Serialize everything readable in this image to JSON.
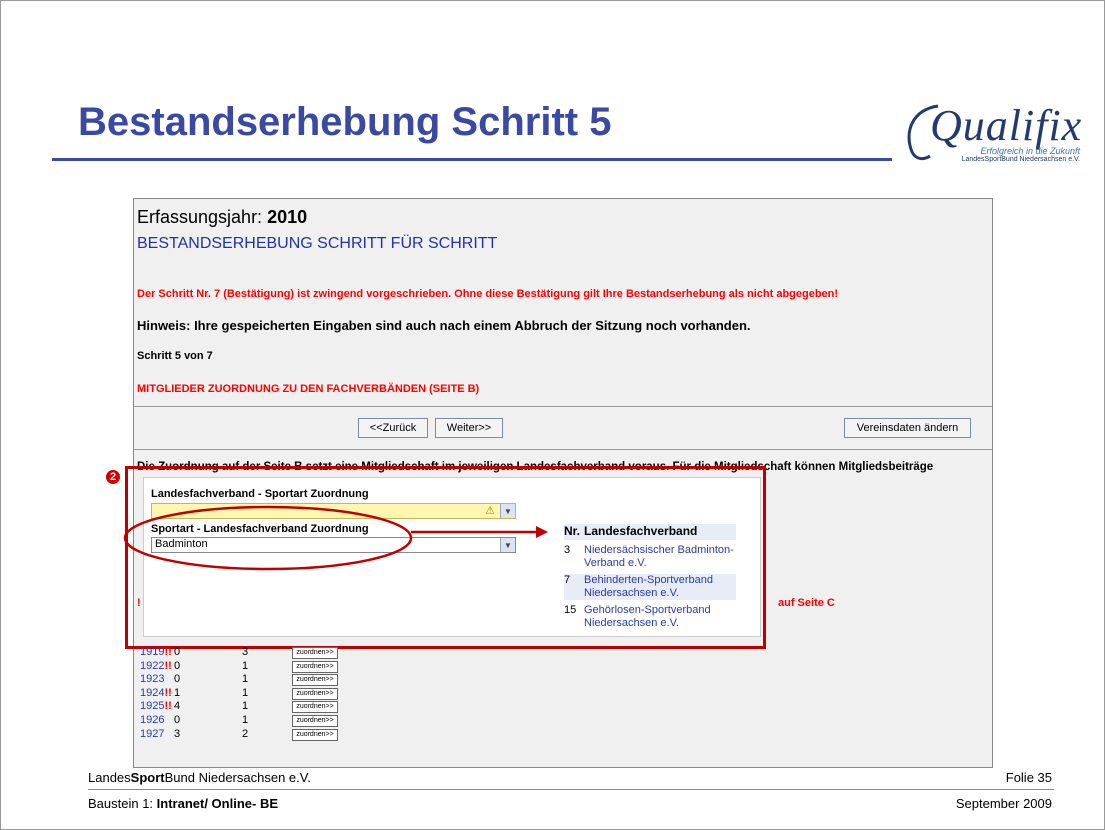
{
  "slide": {
    "title": "Bestandserhebung Schritt 5",
    "logo": {
      "name": "Qualifix",
      "tagline": "Erfolgreich in die Zukunft",
      "org": "LandesSportBund Niedersachsen e.V."
    }
  },
  "form": {
    "year_label": "Erfassungsjahr:",
    "year_value": "2010",
    "heading": "BESTANDSERHEBUNG SCHRITT FÜR SCHRITT",
    "warning": "Der Schritt Nr. 7 (Bestätigung) ist zwingend vorgeschrieben. Ohne diese Bestätigung gilt Ihre Bestandserhebung als nicht abgegeben!",
    "hint": "Hinweis: Ihre gespeicherten Eingaben sind auch nach einem Abbruch der Sitzung noch vorhanden.",
    "step": "Schritt 5 von 7",
    "section": "MITGLIEDER ZUORDNUNG ZU DEN FACHVERBÄNDEN (SEITE B)",
    "buttons": {
      "back": "<<Zurück",
      "next": "Weiter>>",
      "edit_club": "Vereinsdaten ändern"
    },
    "assign_text": "Die Zuordnung auf der Seite B setzt eine Mitgliedschaft im jeweiligen Landesfachverband voraus. Für die Mitgliedschaft können Mitgliedsbeiträge",
    "left_excl": "!",
    "auf_seite": "auf Seite C"
  },
  "popup": {
    "label1": "Landesfachverband - Sportart Zuordnung",
    "warn_icon": "⚠",
    "label2": "Sportart - Landesfachverband Zuordnung",
    "sport_value": "Badminton",
    "table_headers": {
      "nr": "Nr.",
      "name": "Landesfachverband"
    },
    "rows": [
      {
        "nr": "3",
        "name": "Niedersächsischer Badminton-Verband e.V."
      },
      {
        "nr": "7",
        "name": "Behinderten-Sportverband Niedersachsen e.V."
      },
      {
        "nr": "15",
        "name": "Gehörlosen-Sportverband Niedersachsen e.V."
      }
    ]
  },
  "annotation": {
    "badge": "2"
  },
  "years": [
    {
      "year": "1919",
      "excl": "!!",
      "a": "0",
      "b": "3",
      "btn": "zuordnen>>"
    },
    {
      "year": "1922",
      "excl": "!!",
      "a": "0",
      "b": "1",
      "btn": "zuordnen>>"
    },
    {
      "year": "1923",
      "excl": "",
      "a": "0",
      "b": "1",
      "btn": "zuordnen>>"
    },
    {
      "year": "1924",
      "excl": "!!",
      "a": "1",
      "b": "1",
      "btn": "zuordnen>>"
    },
    {
      "year": "1925",
      "excl": "!!",
      "a": "4",
      "b": "1",
      "btn": "zuordnen>>"
    },
    {
      "year": "1926",
      "excl": "",
      "a": "0",
      "b": "1",
      "btn": "zuordnen>>"
    },
    {
      "year": "1927",
      "excl": "",
      "a": "3",
      "b": "2",
      "btn": "zuordnen>>"
    }
  ],
  "footer": {
    "org_prefix": "Landes",
    "org_bold": "Sport",
    "org_suffix": "Bund Niedersachsen e.V.",
    "slide_no": "Folie 35",
    "module_prefix": "Baustein 1: ",
    "module_bold": "Intranet/ Online- BE",
    "date": "September 2009"
  },
  "colors": {
    "title_blue": "#3a4aa3",
    "warning_red": "#ff0000",
    "annotation_red": "#c00000"
  }
}
